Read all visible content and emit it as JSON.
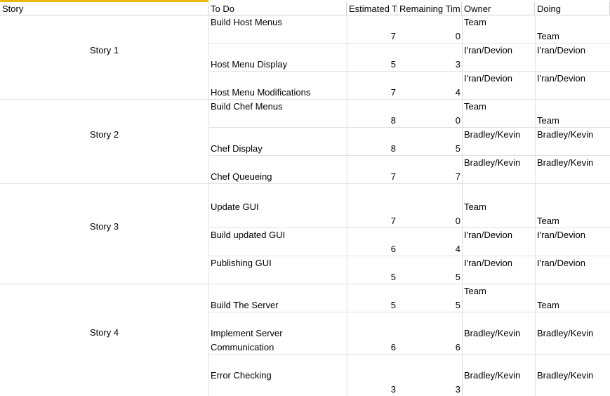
{
  "headers": [
    "Story",
    "To Do",
    "Estimated T",
    "Remaining Tim",
    "Owner",
    "Doing"
  ],
  "stories": [
    {
      "label": "Story 1",
      "tasks": [
        {
          "todo": "Build Host Menus",
          "est": "7",
          "rem": "0",
          "owner": "Team",
          "doing": "Team"
        },
        {
          "todo": "Host Menu Display",
          "est": "5",
          "rem": "3",
          "owner": "I'ran/Devion",
          "doing": "I'ran/Devion"
        },
        {
          "todo": "Host Menu Modifications",
          "est": "7",
          "rem": "4",
          "owner": "I'ran/Devion",
          "doing": "I'ran/Devion"
        }
      ]
    },
    {
      "label": "Story 2",
      "tasks": [
        {
          "todo": "Build Chef Menus",
          "est": "8",
          "rem": "0",
          "owner": "Team",
          "doing": "Team"
        },
        {
          "todo": "Chef Display",
          "est": "8",
          "rem": "5",
          "owner": "Bradley/Kevin",
          "doing": "Bradley/Kevin"
        },
        {
          "todo": "Chef Queueing",
          "est": "7",
          "rem": "7",
          "owner": "Bradley/Kevin",
          "doing": "Bradley/Kevin"
        }
      ]
    },
    {
      "label": "Story 3",
      "tasks": [
        {
          "todo": "Update GUI",
          "est": "7",
          "rem": "0",
          "owner": "Team",
          "doing": "Team"
        },
        {
          "todo": "Build updated GUI",
          "est": "6",
          "rem": "4",
          "owner": "I'ran/Devion",
          "doing": "I'ran/Devion"
        },
        {
          "todo": "Publishing GUI",
          "est": "5",
          "rem": "5",
          "owner": "I'ran/Devion",
          "doing": "I'ran/Devion"
        }
      ]
    },
    {
      "label": "Story 4",
      "tasks": [
        {
          "todo": "Build The Server",
          "est": "5",
          "rem": "5",
          "owner": "Team",
          "doing": "Team"
        },
        {
          "todo": "Implement Server",
          "todo2": "Communication",
          "est": "6",
          "rem": "6",
          "owner": "Bradley/Kevin",
          "doing": "Bradley/Kevin"
        },
        {
          "todo": "Error Checking",
          "est": "3",
          "rem": "3",
          "owner": "Bradley/Kevin",
          "doing": "Bradley/Kevin"
        }
      ]
    }
  ]
}
